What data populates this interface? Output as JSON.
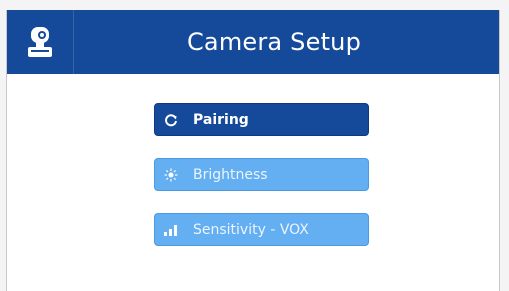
{
  "header": {
    "title": "Camera Setup",
    "icon": "camera-icon",
    "background_color": "#15499a"
  },
  "menu": {
    "items": [
      {
        "label": "Pairing",
        "icon": "refresh-icon",
        "state": "active",
        "color": "#15499a"
      },
      {
        "label": "Brightness",
        "icon": "sun-icon",
        "state": "inactive",
        "color": "#64aef2"
      },
      {
        "label": "Sensitivity - VOX",
        "icon": "signal-bars-icon",
        "state": "inactive",
        "color": "#64aef2"
      }
    ]
  }
}
